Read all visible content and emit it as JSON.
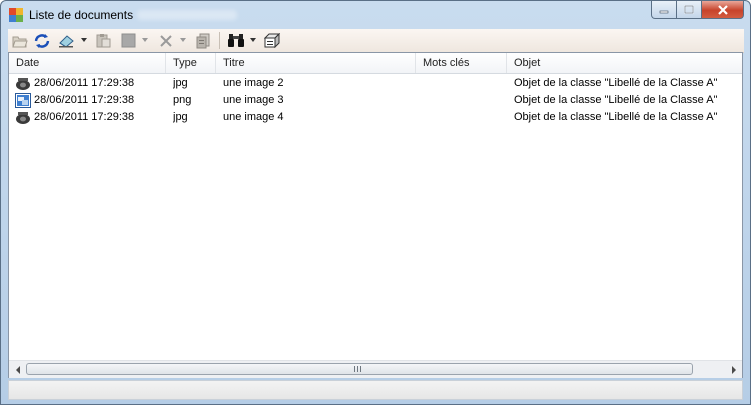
{
  "window": {
    "title": "Liste de documents"
  },
  "toolbar": {
    "buttons": [
      {
        "name": "open-icon",
        "enabled": false
      },
      {
        "name": "refresh-icon",
        "enabled": true
      },
      {
        "name": "edit-icon",
        "enabled": true
      },
      {
        "name": "paste-icon",
        "enabled": false
      },
      {
        "name": "properties-icon",
        "enabled": false
      },
      {
        "name": "delete-icon",
        "enabled": false
      },
      {
        "name": "document-icon",
        "enabled": false
      },
      {
        "name": "binoculars-icon",
        "enabled": true
      },
      {
        "name": "view-icon",
        "enabled": true
      }
    ]
  },
  "list": {
    "columns": [
      "Date",
      "Type",
      "Titre",
      "Mots clés",
      "Objet"
    ],
    "rows": [
      {
        "icon": "jpg-file-icon",
        "date": "28/06/2011 17:29:38",
        "type": "jpg",
        "titre": "une image 2",
        "mots_cles": "",
        "objet": "Objet de la classe \"Libellé de la Classe A\""
      },
      {
        "icon": "png-file-icon",
        "date": "28/06/2011 17:29:38",
        "type": "png",
        "titre": "une image 3",
        "mots_cles": "",
        "objet": "Objet de la classe \"Libellé de la Classe A\""
      },
      {
        "icon": "jpg-file-icon",
        "date": "28/06/2011 17:29:38",
        "type": "jpg",
        "titre": "une image 4",
        "mots_cles": "",
        "objet": "Objet de la classe \"Libellé de la Classe A\""
      }
    ]
  },
  "colors": {
    "title_bar": "#c9dcef",
    "close_button": "#c7432b",
    "toolbar": "#f6efe9",
    "refresh_accent": "#1b4fb8"
  }
}
